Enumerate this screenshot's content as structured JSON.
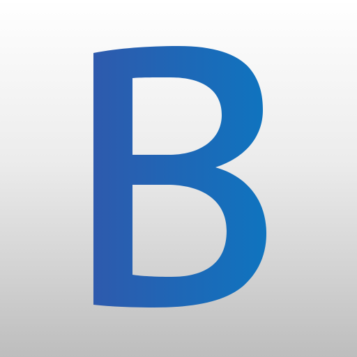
{
  "icon": {
    "letter": "B",
    "name": "letter-b-icon",
    "colors": {
      "background_top": "#ffffff",
      "background_bottom": "#bdbdbd",
      "glyph_left": "#2e5aad",
      "glyph_right": "#0f74bf"
    }
  }
}
